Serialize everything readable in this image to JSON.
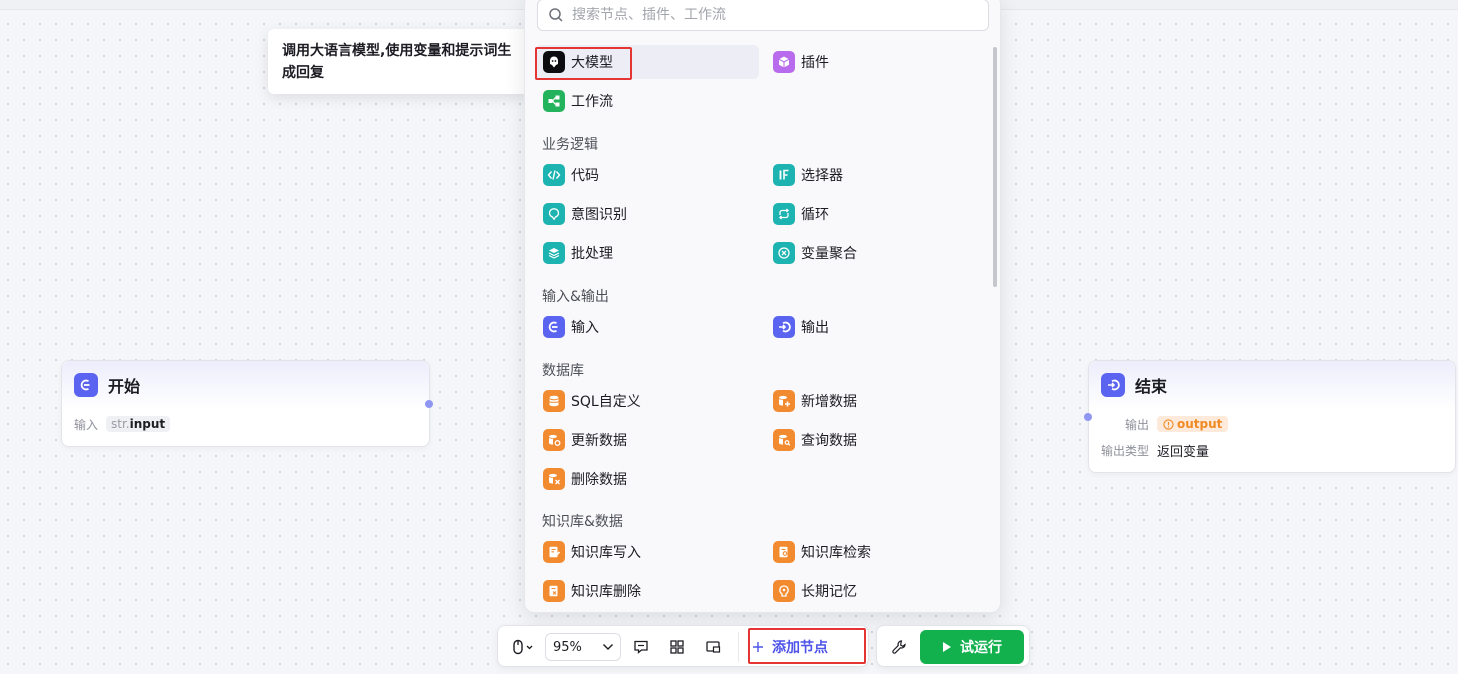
{
  "tooltip": {
    "text": "调用大语言模型,使用变量和提示词生成回复"
  },
  "search": {
    "placeholder": "搜索节点、插件、工作流"
  },
  "panel": {
    "top_items": [
      {
        "label": "大模型",
        "icon": "llm-icon",
        "color": "#0c0c10"
      },
      {
        "label": "插件",
        "icon": "plugin-cube-icon",
        "color": "#b86bec"
      },
      {
        "label": "工作流",
        "icon": "workflow-icon",
        "color": "#22b35c"
      }
    ],
    "sections": [
      {
        "title": "业务逻辑",
        "items": [
          {
            "label": "代码",
            "icon": "code-icon"
          },
          {
            "label": "选择器",
            "icon": "if-icon"
          },
          {
            "label": "意图识别",
            "icon": "intent-icon"
          },
          {
            "label": "循环",
            "icon": "loop-icon"
          },
          {
            "label": "批处理",
            "icon": "batch-layers-icon"
          },
          {
            "label": "变量聚合",
            "icon": "variable-merge-icon"
          }
        ]
      },
      {
        "title": "输入&输出",
        "items": [
          {
            "label": "输入",
            "icon": "input-icon"
          },
          {
            "label": "输出",
            "icon": "output-icon"
          }
        ]
      },
      {
        "title": "数据库",
        "items": [
          {
            "label": "SQL自定义",
            "icon": "database-icon"
          },
          {
            "label": "新增数据",
            "icon": "database-add-icon"
          },
          {
            "label": "更新数据",
            "icon": "database-update-icon"
          },
          {
            "label": "查询数据",
            "icon": "database-query-icon"
          },
          {
            "label": "删除数据",
            "icon": "database-delete-icon"
          }
        ]
      },
      {
        "title": "知识库&数据",
        "items": [
          {
            "label": "知识库写入",
            "icon": "knowledge-write-icon"
          },
          {
            "label": "知识库检索",
            "icon": "knowledge-search-icon"
          },
          {
            "label": "知识库删除",
            "icon": "knowledge-delete-icon"
          },
          {
            "label": "长期记忆",
            "icon": "memory-icon"
          }
        ]
      }
    ]
  },
  "start_node": {
    "title": "开始",
    "input_label": "输入",
    "input_type": "str.",
    "input_name": "input"
  },
  "end_node": {
    "title": "结束",
    "output_label": "输出",
    "output_var": "output",
    "output_type_label": "输出类型",
    "output_type_value": "返回变量"
  },
  "toolbar": {
    "zoom": "95%",
    "add_node": "添加节点",
    "run": "试运行"
  },
  "colors": {
    "accent": "#4d53e8",
    "run": "#13b04e",
    "highlight": "#e53434"
  }
}
